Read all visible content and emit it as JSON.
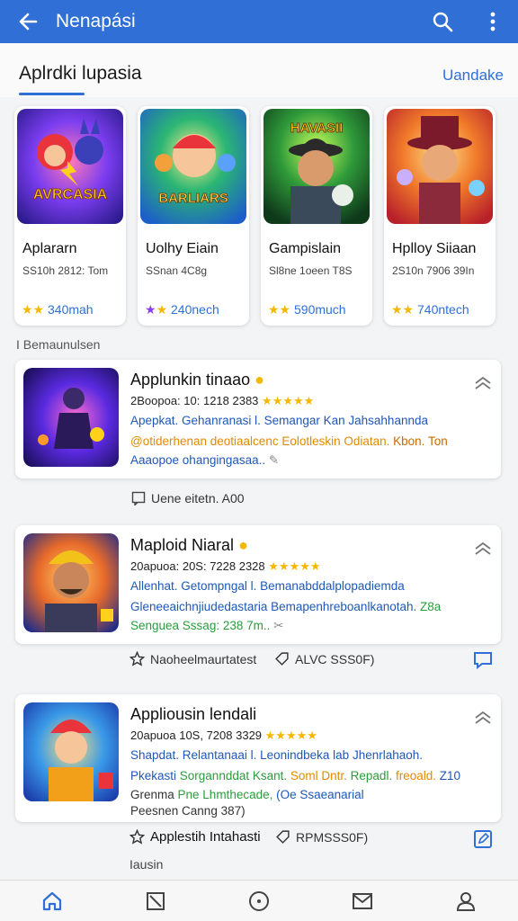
{
  "appbar": {
    "title": "Nenapási"
  },
  "section": {
    "title": "Aplrdki lupasia",
    "more": "Uandake"
  },
  "featured": [
    {
      "name": "Aplararn",
      "meta": "SS10h 2812: Tom",
      "rating": "340mah",
      "art_text": "AVRCASIA"
    },
    {
      "name": "Uolhy Eiain",
      "meta": "SSnan 4C8g",
      "rating": "240nech",
      "art_text": "BARLIARS"
    },
    {
      "name": "Gampislain",
      "meta": "Sl8ne 1oeen T8S",
      "rating": "590much",
      "art_text": "HAVASII"
    },
    {
      "name": "Hplloy Siiaan",
      "meta": "2S10n 7906 39In",
      "rating": "740ntech",
      "art_text": ""
    }
  ],
  "list_label": "I Bemaunulsen",
  "list": [
    {
      "name": "Applunkin tinaao",
      "meta": "2Boopoa: 10: 1218 2383",
      "line1": "Apepkat. Gehanranasi l. Semangar Kan Jahsahhannda",
      "line2": [
        {
          "text": "@otiderhenan deotiaalcenc Eolotleskin Odiatan. ",
          "color": "#e08a00"
        },
        {
          "text": "Kbon. Ton",
          "color": "#c86a00"
        }
      ],
      "line3": [
        {
          "text": "Aaaopoe ohangingasaa..",
          "color": "#1e58b8"
        }
      ],
      "footer": {
        "left": "Uene eitetn. A00",
        "mid": "",
        "right": ""
      }
    },
    {
      "name": "Maploid Niaral",
      "meta": "20apuoa: 20S: 7228 2328",
      "line1": "Allenhat. Getompngal l. Bemanabddalplopadiemda",
      "line2": [
        {
          "text": "Gleneeaichnjiudedastaria Bemapenhreboanlkanotah. ",
          "color": "#1e58b8"
        },
        {
          "text": "Z8a",
          "color": "#2a9d3a"
        }
      ],
      "line3": [
        {
          "text": "Senguea Sssag: 238 7m..",
          "color": "#2a9d3a"
        }
      ],
      "footer": {
        "left": "Naoheelmaurtatest",
        "mid": "ALVC SSS0F)",
        "right": ""
      }
    },
    {
      "name": "Appliousin lendali",
      "meta": "20apuoa 10S, 7208 3329",
      "line1": "Shapdat. Relantanaai l. Leonindbeka lab Jhenrlahaoh.",
      "line2": [
        {
          "text": "Pkekasti ",
          "color": "#1e58b8"
        },
        {
          "text": "Sorgannddat Ksant. ",
          "color": "#2a9d3a"
        },
        {
          "text": "Soml Dntr. ",
          "color": "#e08a00"
        },
        {
          "text": "Repadl. ",
          "color": "#2a9d3a"
        },
        {
          "text": "freoald. ",
          "color": "#e08a00"
        },
        {
          "text": "Z10",
          "color": "#1e58b8"
        }
      ],
      "line3": [
        {
          "text": "Grenma ",
          "color": "#333333"
        },
        {
          "text": "Pne Lhmthecade, ",
          "color": "#2a9d3a"
        },
        {
          "text": "(Oe Ssaeanarial",
          "color": "#1e58b8"
        }
      ],
      "line4": "Peesnen Canng 387)",
      "footer": {
        "left": "Applestih Intahasti",
        "mid": "RPMSSS0F)",
        "right": ""
      }
    }
  ],
  "trailing_text": "Iausin",
  "colors": {
    "primary": "#2f6fd6",
    "star": "#f5b800",
    "orange": "#e08a00",
    "green": "#2a9d3a"
  },
  "icons": {
    "appbar": [
      "back-arrow-icon",
      "search-icon",
      "more-vert-icon"
    ],
    "bottom_nav": [
      "home-icon",
      "library-icon",
      "compass-icon",
      "mail-icon",
      "profile-icon"
    ]
  }
}
